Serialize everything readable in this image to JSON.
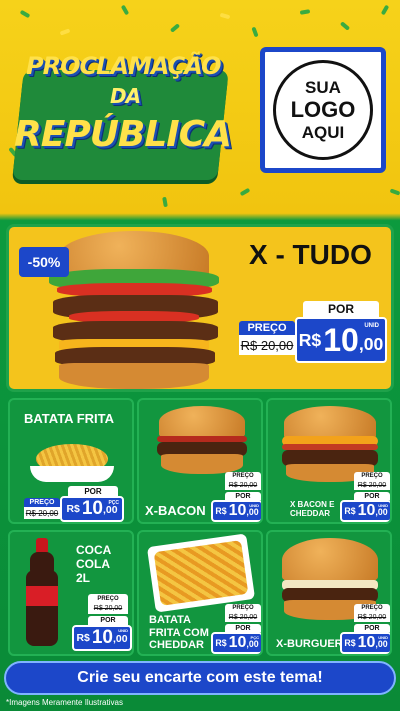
{
  "header": {
    "title_line1": "PROCLAMAÇÃO",
    "title_line2": "DA",
    "title_line3": "REPÚBLICA",
    "logo_lines": [
      "SUA",
      "LOGO",
      "AQUI"
    ]
  },
  "main": {
    "discount": "-50%",
    "name": "X - TUDO",
    "price_label": "PREÇO",
    "old_price": "R$ 20,00",
    "por_label": "POR",
    "currency": "R$",
    "price_int": "10",
    "price_cents": ",00",
    "unit": "UNID"
  },
  "products": [
    {
      "name": "BATATA FRITA",
      "price_label": "PREÇO",
      "old_price": "R$ 20,00",
      "por_label": "POR",
      "currency": "R$",
      "price_int": "10",
      "price_cents": ",00",
      "unit": "PÇC"
    },
    {
      "name": "X-BACON",
      "price_label": "PREÇO",
      "old_price": "R$ 20,00",
      "por_label": "POR",
      "currency": "R$",
      "price_int": "10",
      "price_cents": ",00",
      "unit": "UNID"
    },
    {
      "name": "X BACON E CHEDDAR",
      "price_label": "PREÇO",
      "old_price": "R$ 20,00",
      "por_label": "POR",
      "currency": "R$",
      "price_int": "10",
      "price_cents": ",00",
      "unit": "UNID"
    },
    {
      "name": "COCA COLA 2L",
      "price_label": "PREÇO",
      "old_price": "R$ 20,00",
      "por_label": "POR",
      "currency": "R$",
      "price_int": "10",
      "price_cents": ",00",
      "unit": "UNID"
    },
    {
      "name": "BATATA FRITA COM CHEDDAR",
      "price_label": "PREÇO",
      "old_price": "R$ 20,00",
      "por_label": "POR",
      "currency": "R$",
      "price_int": "10",
      "price_cents": ",00",
      "unit": "PÇC"
    },
    {
      "name": "X-BURGUER",
      "price_label": "PREÇO",
      "old_price": "R$ 20,00",
      "por_label": "POR",
      "currency": "R$",
      "price_int": "10",
      "price_cents": ",00",
      "unit": "UNID"
    }
  ],
  "cta": "Crie seu encarte com este tema!",
  "footnote": "*Imagens Meramente Ilustrativas",
  "colors": {
    "green": "#12963f",
    "yellow": "#f4c41c",
    "blue": "#1c47c9"
  },
  "icons": [
    "burger-icon",
    "fries-icon",
    "soda-bottle-icon"
  ]
}
